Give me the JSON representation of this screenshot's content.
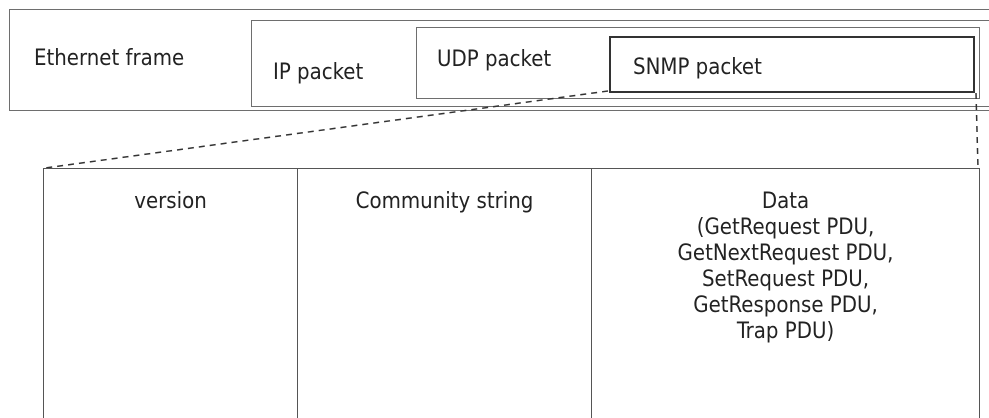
{
  "layers": {
    "ethernet": "Ethernet frame",
    "ip": "IP packet",
    "udp": "UDP packet",
    "snmp": "SNMP packet"
  },
  "snmp_fields": {
    "version": "version",
    "community": "Community string",
    "data_title": "Data",
    "data_items": [
      "(GetRequest PDU,",
      "GetNextRequest PDU,",
      "SetRequest PDU,",
      "GetResponse PDU,",
      "Trap PDU)"
    ]
  }
}
